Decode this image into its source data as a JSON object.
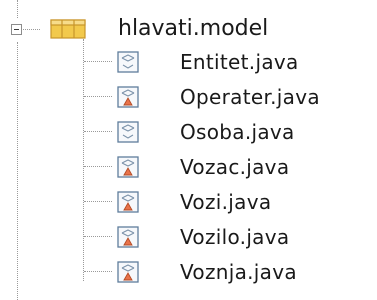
{
  "package": {
    "label": "hlavati.model",
    "icon": "package-icon",
    "expanded": true
  },
  "files": [
    {
      "label": "Entitet.java",
      "icon": "java-class-icon",
      "modified": false
    },
    {
      "label": "Operater.java",
      "icon": "java-class-icon",
      "modified": true
    },
    {
      "label": "Osoba.java",
      "icon": "java-class-icon",
      "modified": false
    },
    {
      "label": "Vozac.java",
      "icon": "java-class-icon",
      "modified": true
    },
    {
      "label": "Vozi.java",
      "icon": "java-class-icon",
      "modified": true
    },
    {
      "label": "Vozilo.java",
      "icon": "java-class-icon",
      "modified": true
    },
    {
      "label": "Voznja.java",
      "icon": "java-class-icon",
      "modified": true
    }
  ],
  "colors": {
    "package_fill": "#f2c94c",
    "package_stroke": "#c8952a",
    "file_stroke": "#5f7d9c",
    "badge_fill": "#e9734a"
  }
}
